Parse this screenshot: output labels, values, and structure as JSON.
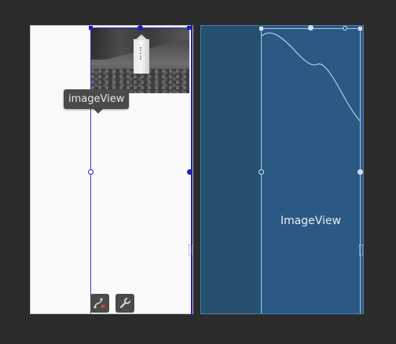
{
  "design": {
    "tooltip": "imageView"
  },
  "blueprint": {
    "view_label": "ImageView"
  },
  "toolbar": {
    "clear_constraints_icon": "clear-constraints-icon",
    "attributes_icon": "wrench-icon"
  },
  "colors": {
    "background": "#2b2b2b",
    "selection": "#1f1fbf",
    "blueprint": "#2c5984",
    "blueprint_line": "#a9c7e6"
  }
}
